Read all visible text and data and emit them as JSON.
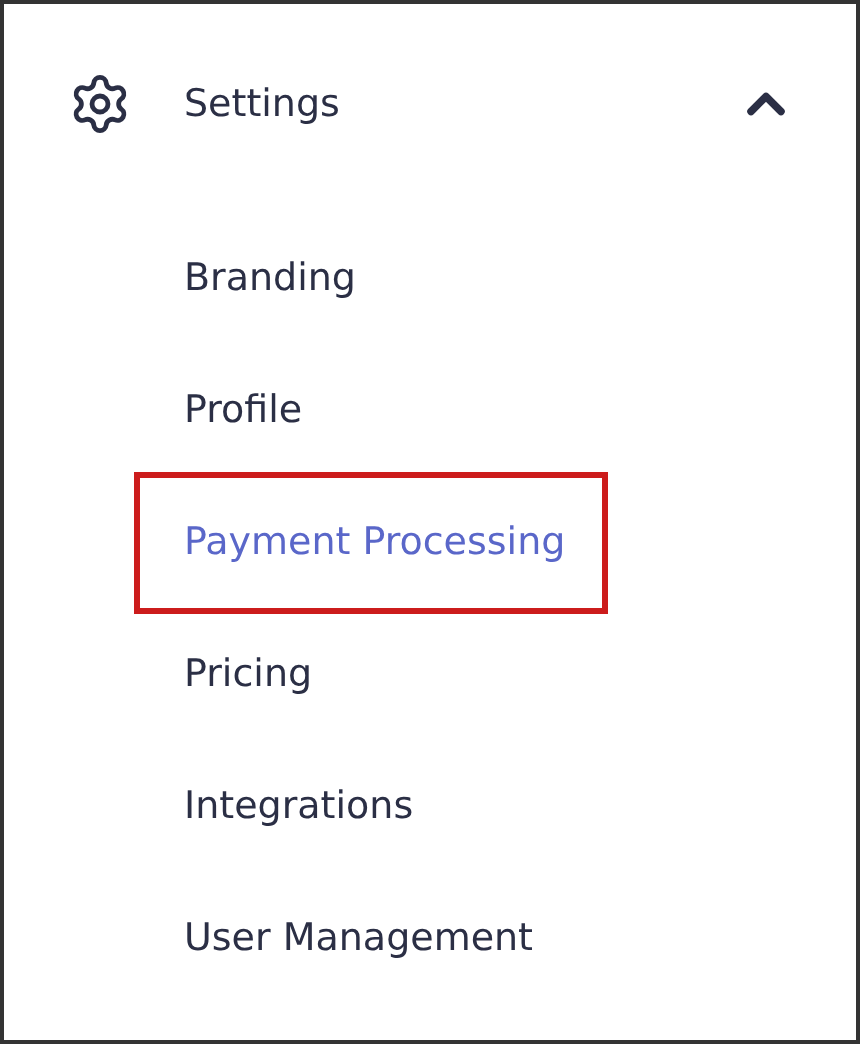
{
  "menu": {
    "title": "Settings",
    "expanded": true,
    "items": [
      {
        "label": "Branding",
        "selected": false,
        "highlighted": false
      },
      {
        "label": "Profile",
        "selected": false,
        "highlighted": false
      },
      {
        "label": "Payment Processing",
        "selected": true,
        "highlighted": true
      },
      {
        "label": "Pricing",
        "selected": false,
        "highlighted": false
      },
      {
        "label": "Integrations",
        "selected": false,
        "highlighted": false
      },
      {
        "label": "User Management",
        "selected": false,
        "highlighted": false
      }
    ]
  }
}
